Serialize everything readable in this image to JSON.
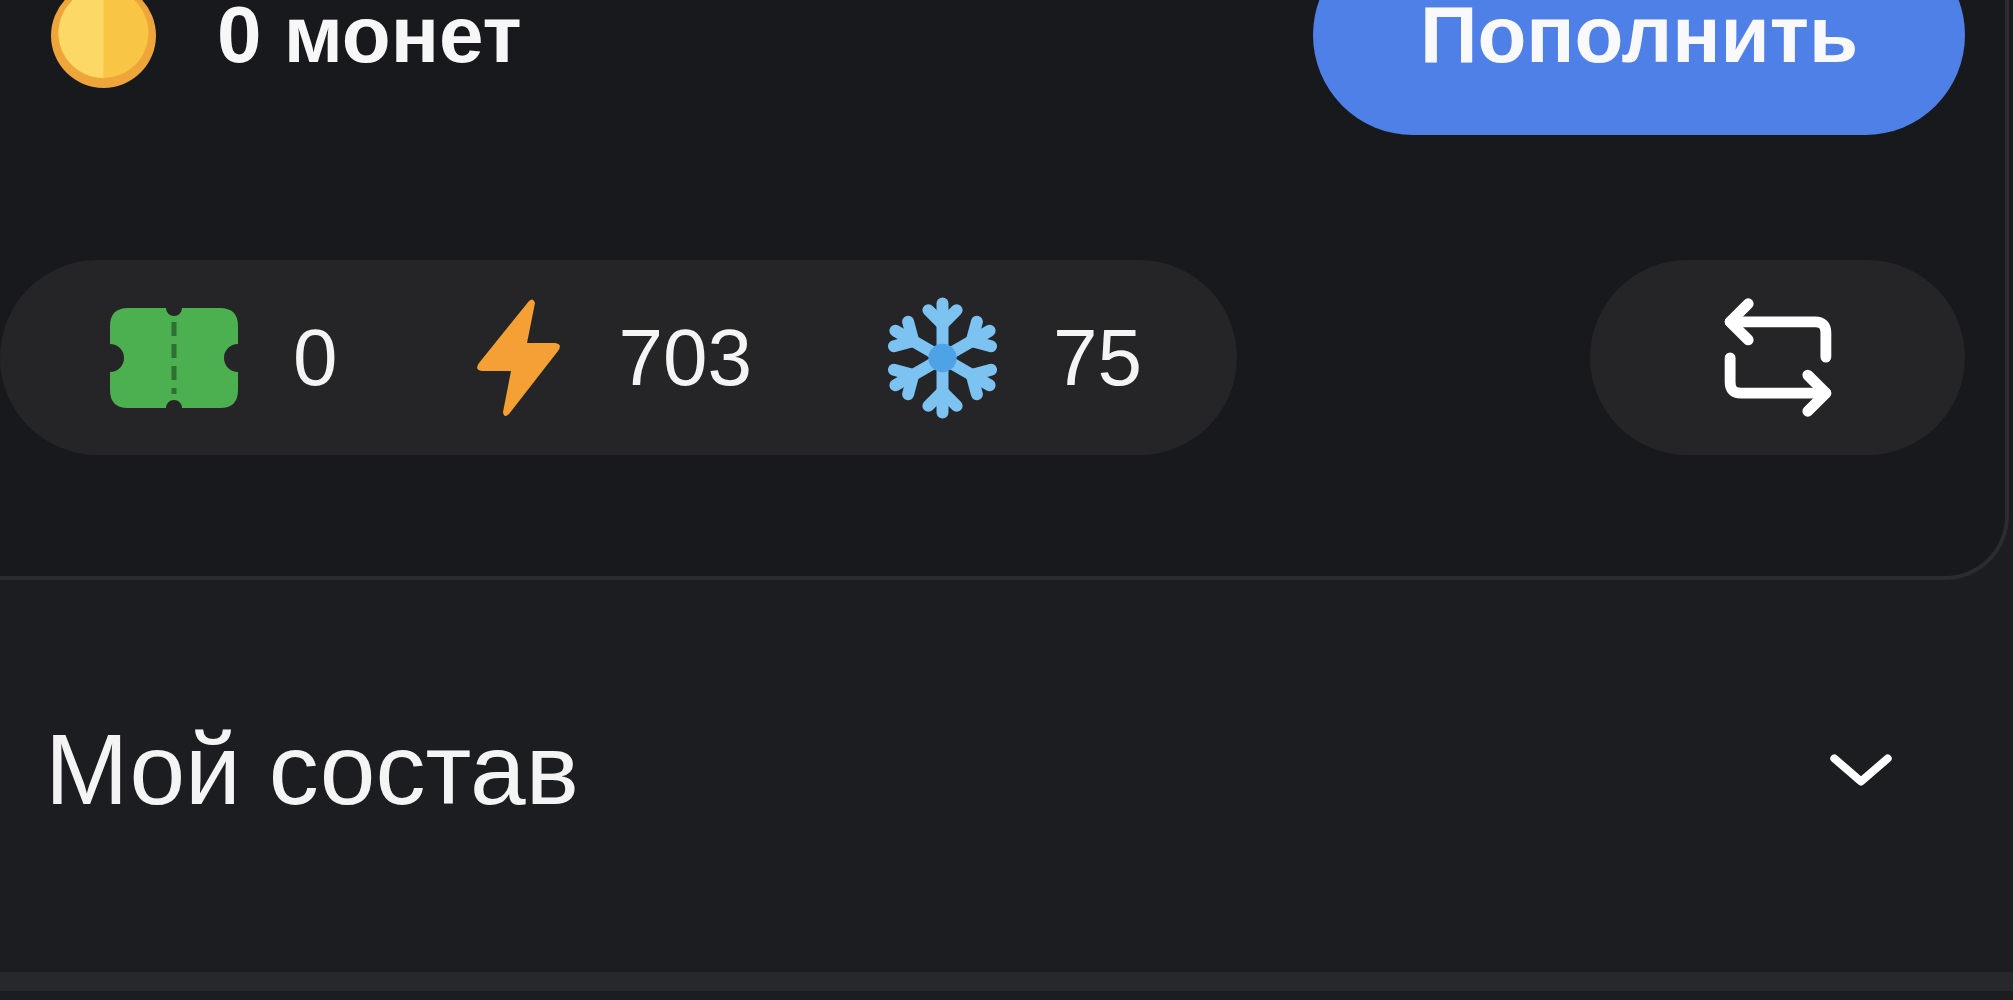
{
  "balance": {
    "text": "0 монет"
  },
  "top_up_button": {
    "label": "Пополнить"
  },
  "stats": [
    {
      "kind": "ticket",
      "value": "0"
    },
    {
      "kind": "energy",
      "value": "703"
    },
    {
      "kind": "freeze",
      "value": "75"
    }
  ],
  "team_section": {
    "title": "Мой состав",
    "expanded": false
  }
}
